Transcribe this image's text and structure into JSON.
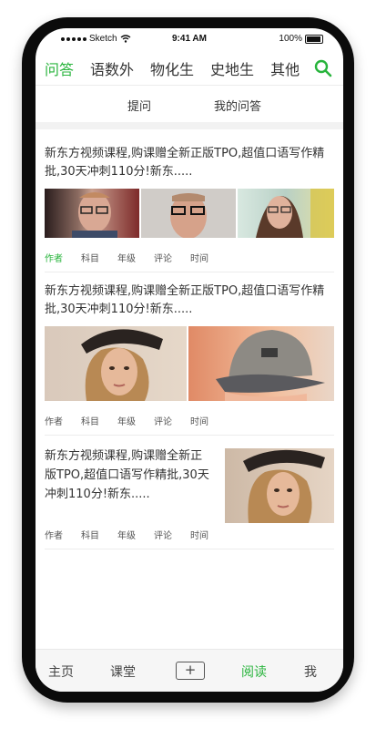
{
  "status": {
    "carrier": "Sketch",
    "time": "9:41 AM",
    "battery": "100%"
  },
  "top_tabs": [
    "问答",
    "语数外",
    "物化生",
    "史地生",
    "其他"
  ],
  "sub_tabs": [
    "提问",
    "我的问答"
  ],
  "posts": [
    {
      "title": "新东方视频课程,购课赠全新正版TPO,超值口语写作精批,30天冲刺110分!新东.....",
      "meta": [
        "作者",
        "科目",
        "年级",
        "评论",
        "时间"
      ]
    },
    {
      "title": "新东方视频课程,购课赠全新正版TPO,超值口语写作精批,30天冲刺110分!新东.....",
      "meta": [
        "作者",
        "科目",
        "年级",
        "评论",
        "时间"
      ]
    },
    {
      "title": "新东方视频课程,购课赠全新正版TPO,超值口语写作精批,30天冲刺110分!新东.....",
      "meta": [
        "作者",
        "科目",
        "年级",
        "评论",
        "时间"
      ]
    }
  ],
  "bottom_nav": [
    "主页",
    "课堂",
    "+",
    "阅读",
    "我"
  ],
  "colors": {
    "accent": "#28b43c",
    "text": "#333333"
  }
}
